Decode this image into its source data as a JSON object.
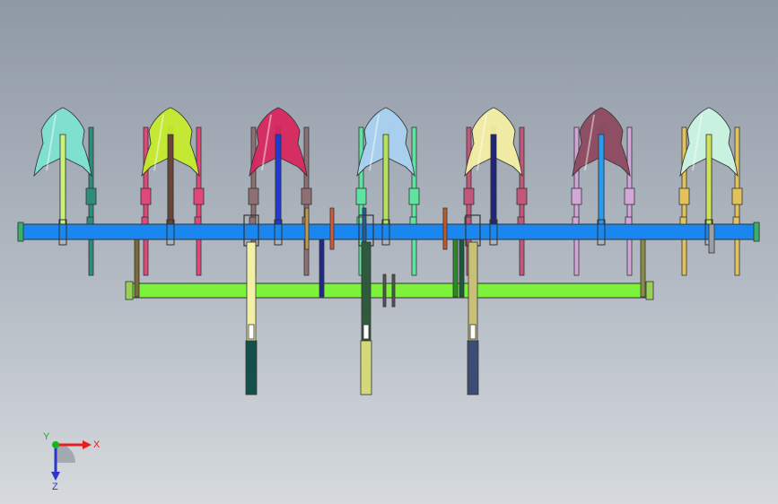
{
  "view": {
    "background_top": "#8f99a6",
    "background_bottom": "#d6dade",
    "outline_color": "#333333"
  },
  "frame": {
    "main_beam_color": "#1a86ef",
    "lower_bar_color": "#7cf23a"
  },
  "tines": [
    {
      "shovel_color": "#7fe3d2",
      "stem_color": "#c8f27a",
      "pair_color": "#2f8c7a"
    },
    {
      "shovel_color": "#c6ec2e",
      "stem_color": "#6b4636",
      "pair_color": "#e0487a"
    },
    {
      "shovel_color": "#d7285f",
      "stem_color": "#1f3ad6",
      "pair_color": "#8e6f73"
    },
    {
      "shovel_color": "#a9d3f2",
      "stem_color": "#b5e25c",
      "pair_color": "#5fe3a0"
    },
    {
      "shovel_color": "#f5f0a5",
      "stem_color": "#20247a",
      "pair_color": "#c1577a"
    },
    {
      "shovel_color": "#8e4a60",
      "stem_color": "#2a9cf0",
      "pair_color": "#d3a6d8"
    },
    {
      "shovel_color": "#ccf5e3",
      "stem_color": "#cfe35a",
      "pair_color": "#e2c25a"
    }
  ],
  "gauge_wheels": [
    {
      "upper_color": "#f2f0a5",
      "lower_color": "#14504a"
    },
    {
      "upper_color": "#2f5a3e",
      "lower_color": "#d4d77a"
    },
    {
      "upper_color": "#c9c077",
      "lower_color": "#3c4c74"
    }
  ],
  "triad": {
    "x_label": "X",
    "y_label": "Y",
    "z_label": "Z",
    "x_color": "#e61e1e",
    "y_color": "#18b31a",
    "z_color": "#2a35c9"
  }
}
